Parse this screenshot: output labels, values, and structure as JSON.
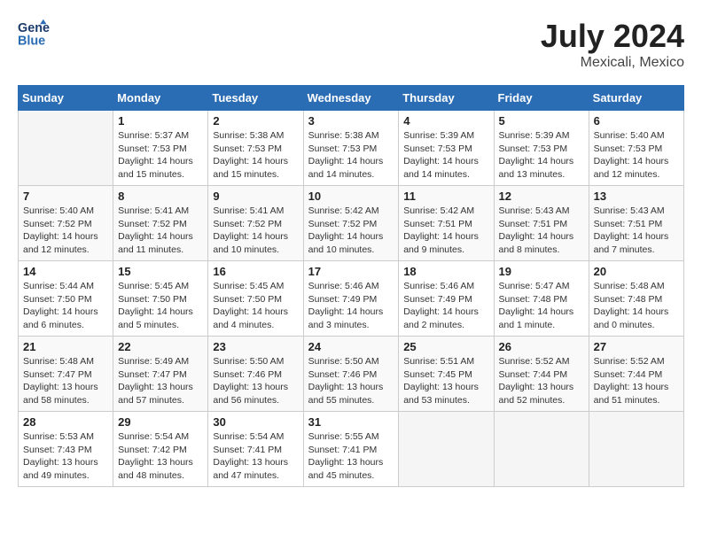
{
  "header": {
    "logo_line1": "General",
    "logo_line2": "Blue",
    "month_year": "July 2024",
    "location": "Mexicali, Mexico"
  },
  "days_of_week": [
    "Sunday",
    "Monday",
    "Tuesday",
    "Wednesday",
    "Thursday",
    "Friday",
    "Saturday"
  ],
  "weeks": [
    [
      {
        "day": "",
        "info": ""
      },
      {
        "day": "1",
        "info": "Sunrise: 5:37 AM\nSunset: 7:53 PM\nDaylight: 14 hours\nand 15 minutes."
      },
      {
        "day": "2",
        "info": "Sunrise: 5:38 AM\nSunset: 7:53 PM\nDaylight: 14 hours\nand 15 minutes."
      },
      {
        "day": "3",
        "info": "Sunrise: 5:38 AM\nSunset: 7:53 PM\nDaylight: 14 hours\nand 14 minutes."
      },
      {
        "day": "4",
        "info": "Sunrise: 5:39 AM\nSunset: 7:53 PM\nDaylight: 14 hours\nand 14 minutes."
      },
      {
        "day": "5",
        "info": "Sunrise: 5:39 AM\nSunset: 7:53 PM\nDaylight: 14 hours\nand 13 minutes."
      },
      {
        "day": "6",
        "info": "Sunrise: 5:40 AM\nSunset: 7:53 PM\nDaylight: 14 hours\nand 12 minutes."
      }
    ],
    [
      {
        "day": "7",
        "info": "Sunrise: 5:40 AM\nSunset: 7:52 PM\nDaylight: 14 hours\nand 12 minutes."
      },
      {
        "day": "8",
        "info": "Sunrise: 5:41 AM\nSunset: 7:52 PM\nDaylight: 14 hours\nand 11 minutes."
      },
      {
        "day": "9",
        "info": "Sunrise: 5:41 AM\nSunset: 7:52 PM\nDaylight: 14 hours\nand 10 minutes."
      },
      {
        "day": "10",
        "info": "Sunrise: 5:42 AM\nSunset: 7:52 PM\nDaylight: 14 hours\nand 10 minutes."
      },
      {
        "day": "11",
        "info": "Sunrise: 5:42 AM\nSunset: 7:51 PM\nDaylight: 14 hours\nand 9 minutes."
      },
      {
        "day": "12",
        "info": "Sunrise: 5:43 AM\nSunset: 7:51 PM\nDaylight: 14 hours\nand 8 minutes."
      },
      {
        "day": "13",
        "info": "Sunrise: 5:43 AM\nSunset: 7:51 PM\nDaylight: 14 hours\nand 7 minutes."
      }
    ],
    [
      {
        "day": "14",
        "info": "Sunrise: 5:44 AM\nSunset: 7:50 PM\nDaylight: 14 hours\nand 6 minutes."
      },
      {
        "day": "15",
        "info": "Sunrise: 5:45 AM\nSunset: 7:50 PM\nDaylight: 14 hours\nand 5 minutes."
      },
      {
        "day": "16",
        "info": "Sunrise: 5:45 AM\nSunset: 7:50 PM\nDaylight: 14 hours\nand 4 minutes."
      },
      {
        "day": "17",
        "info": "Sunrise: 5:46 AM\nSunset: 7:49 PM\nDaylight: 14 hours\nand 3 minutes."
      },
      {
        "day": "18",
        "info": "Sunrise: 5:46 AM\nSunset: 7:49 PM\nDaylight: 14 hours\nand 2 minutes."
      },
      {
        "day": "19",
        "info": "Sunrise: 5:47 AM\nSunset: 7:48 PM\nDaylight: 14 hours\nand 1 minute."
      },
      {
        "day": "20",
        "info": "Sunrise: 5:48 AM\nSunset: 7:48 PM\nDaylight: 14 hours\nand 0 minutes."
      }
    ],
    [
      {
        "day": "21",
        "info": "Sunrise: 5:48 AM\nSunset: 7:47 PM\nDaylight: 13 hours\nand 58 minutes."
      },
      {
        "day": "22",
        "info": "Sunrise: 5:49 AM\nSunset: 7:47 PM\nDaylight: 13 hours\nand 57 minutes."
      },
      {
        "day": "23",
        "info": "Sunrise: 5:50 AM\nSunset: 7:46 PM\nDaylight: 13 hours\nand 56 minutes."
      },
      {
        "day": "24",
        "info": "Sunrise: 5:50 AM\nSunset: 7:46 PM\nDaylight: 13 hours\nand 55 minutes."
      },
      {
        "day": "25",
        "info": "Sunrise: 5:51 AM\nSunset: 7:45 PM\nDaylight: 13 hours\nand 53 minutes."
      },
      {
        "day": "26",
        "info": "Sunrise: 5:52 AM\nSunset: 7:44 PM\nDaylight: 13 hours\nand 52 minutes."
      },
      {
        "day": "27",
        "info": "Sunrise: 5:52 AM\nSunset: 7:44 PM\nDaylight: 13 hours\nand 51 minutes."
      }
    ],
    [
      {
        "day": "28",
        "info": "Sunrise: 5:53 AM\nSunset: 7:43 PM\nDaylight: 13 hours\nand 49 minutes."
      },
      {
        "day": "29",
        "info": "Sunrise: 5:54 AM\nSunset: 7:42 PM\nDaylight: 13 hours\nand 48 minutes."
      },
      {
        "day": "30",
        "info": "Sunrise: 5:54 AM\nSunset: 7:41 PM\nDaylight: 13 hours\nand 47 minutes."
      },
      {
        "day": "31",
        "info": "Sunrise: 5:55 AM\nSunset: 7:41 PM\nDaylight: 13 hours\nand 45 minutes."
      },
      {
        "day": "",
        "info": ""
      },
      {
        "day": "",
        "info": ""
      },
      {
        "day": "",
        "info": ""
      }
    ]
  ]
}
